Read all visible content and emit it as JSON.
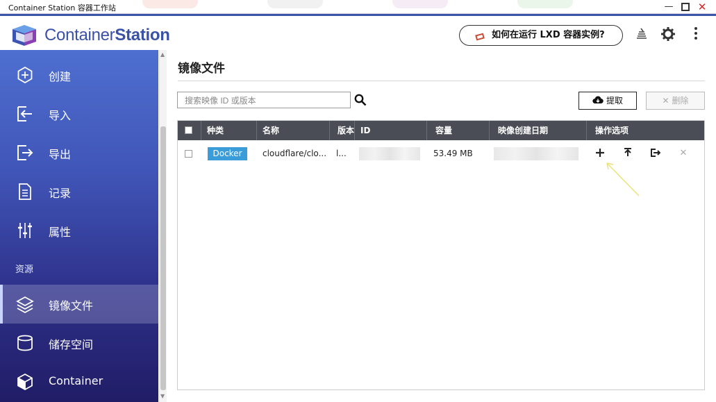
{
  "window": {
    "title": "Container Station 容器工作站",
    "controls": [
      "minimize",
      "maximize",
      "close"
    ]
  },
  "header": {
    "logo_regular": "Container",
    "logo_bold": "Station",
    "lxd_button": "如何在运行 LXD 容器实例?",
    "icons": [
      "stack-icon",
      "gear-icon",
      "more-icon"
    ]
  },
  "sidebar": {
    "items": [
      {
        "label": "创建",
        "icon": "plus-circle-icon"
      },
      {
        "label": "导入",
        "icon": "import-icon"
      },
      {
        "label": "导出",
        "icon": "export-icon"
      },
      {
        "label": "记录",
        "icon": "document-icon"
      },
      {
        "label": "属性",
        "icon": "sliders-icon"
      }
    ],
    "section_label": "资源",
    "resource_items": [
      {
        "label": "镜像文件",
        "icon": "layers-icon",
        "active": true
      },
      {
        "label": "储存空间",
        "icon": "storage-icon"
      },
      {
        "label": "Container",
        "icon": "cube-icon"
      }
    ]
  },
  "main": {
    "title": "镜像文件",
    "search_placeholder": "搜索映像 ID 或版本",
    "pull_button": "提取",
    "delete_button": "删除",
    "columns": [
      "种类",
      "名称",
      "版本",
      "ID",
      "容量",
      "映像创建日期",
      "操作选项"
    ],
    "rows": [
      {
        "type": "Docker",
        "name": "cloudflare/clo...",
        "version": "l...",
        "size": "53.49 MB"
      }
    ],
    "accent_color": "#3a9cd8"
  }
}
